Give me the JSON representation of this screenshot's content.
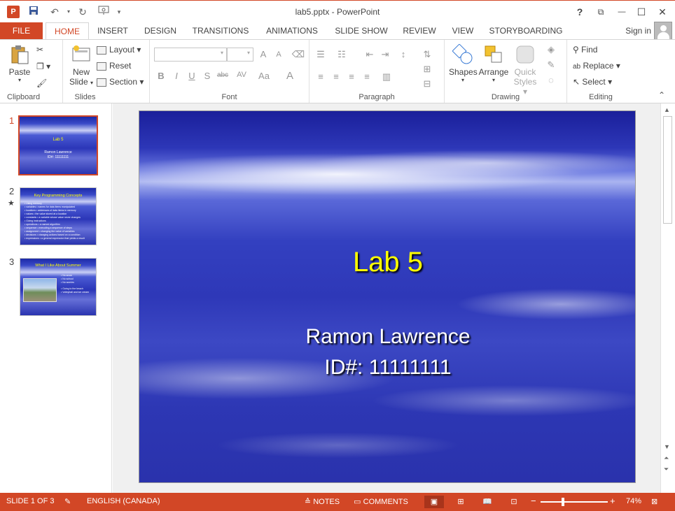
{
  "window": {
    "title": "lab5.pptx - PowerPoint",
    "app_icon_letter": "P",
    "help": "?",
    "restore_ribbon": "⧉",
    "minimize": "—",
    "maximize": "☐",
    "close": "✕"
  },
  "tabs": [
    {
      "label": "FILE"
    },
    {
      "label": "HOME"
    },
    {
      "label": "INSERT"
    },
    {
      "label": "DESIGN"
    },
    {
      "label": "TRANSITIONS"
    },
    {
      "label": "ANIMATIONS"
    },
    {
      "label": "SLIDE SHOW"
    },
    {
      "label": "REVIEW"
    },
    {
      "label": "VIEW"
    },
    {
      "label": "STORYBOARDING"
    }
  ],
  "signin": "Sign in",
  "ribbon": {
    "clipboard": {
      "label": "Clipboard",
      "paste": "Paste"
    },
    "slides": {
      "label": "Slides",
      "new_slide": "New",
      "new_slide2": "Slide",
      "layout": "Layout",
      "reset": "Reset",
      "section": "Section"
    },
    "font": {
      "label": "Font",
      "bold": "B",
      "italic": "I",
      "underline": "U",
      "strike": "S",
      "shadow": "abc",
      "spacing": "AV",
      "case": "Aa",
      "color": "A",
      "grow": "A",
      "shrink": "A"
    },
    "paragraph": {
      "label": "Paragraph"
    },
    "drawing": {
      "label": "Drawing",
      "shapes": "Shapes",
      "arrange": "Arrange",
      "quick_styles": "Quick",
      "quick_styles2": "Styles"
    },
    "editing": {
      "label": "Editing",
      "find": "Find",
      "replace": "Replace",
      "select": "Select"
    }
  },
  "thumbnails": [
    {
      "number": "1",
      "title": "Lab 5",
      "lines": [
        "Ramon Lawrence",
        "ID#: 11111111"
      ]
    },
    {
      "number": "2",
      "title": "Key Programming Concepts",
      "lines": [
        "• Using memory",
        "• variables • names for data items manipulated",
        "• locations • addresses of data items in memory",
        "• values • the value stored at a location",
        "• constants • a variable whose value never changes",
        "• Giving instructions",
        "• operations • a named algorithm",
        "• sequence • executing a sequence of steps",
        "• assignment • changing the value of variables",
        "• decisions • changing actions based on a condition",
        "• expressions • a general expression that yields a result"
      ]
    },
    {
      "number": "3",
      "title": "What I Like About Summer",
      "lines": [
        "• No snow",
        "• No school",
        "• No worries",
        "• Going to the beach",
        "• Volleyball and ice cream"
      ]
    }
  ],
  "slide": {
    "title": "Lab 5",
    "subtitle_line1": "Ramon Lawrence",
    "subtitle_line2": "ID#: 11111111"
  },
  "status": {
    "slide_info": "SLIDE 1 OF 3",
    "language": "ENGLISH (CANADA)",
    "notes": "NOTES",
    "comments": "COMMENTS",
    "zoom_minus": "−",
    "zoom_plus": "+",
    "zoom": "74%"
  },
  "colors": {
    "accent": "#d24726",
    "title_yellow": "#ffff00"
  }
}
